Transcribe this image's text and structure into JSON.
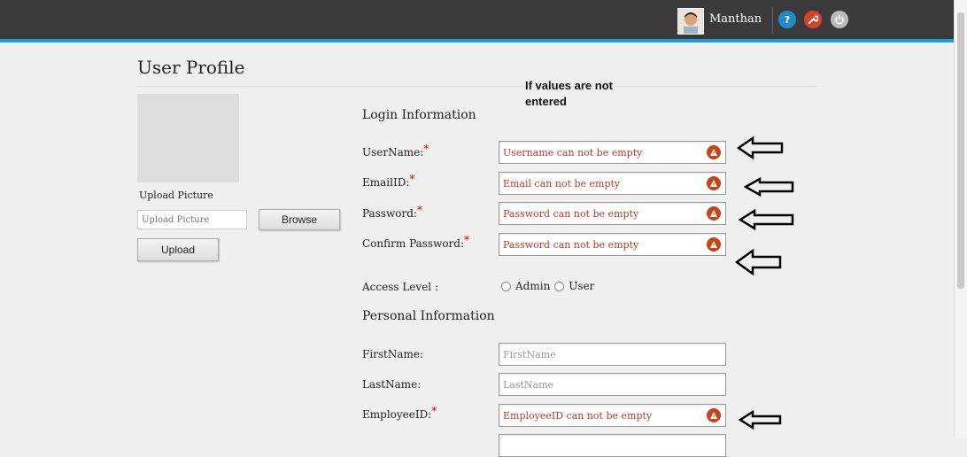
{
  "header": {
    "user_name": "Manthan",
    "icons": [
      "help-icon",
      "settings-wrench-icon",
      "power-icon"
    ],
    "accent_color": "#1b9be0"
  },
  "page": {
    "title": "User Profile"
  },
  "annotation": {
    "text": "If values are not entered"
  },
  "picture": {
    "upload_label": "Upload Picture",
    "input_placeholder": "Upload Picture",
    "browse_label": "Browse",
    "upload_label_btn": "Upload"
  },
  "login": {
    "section_title": "Login Information",
    "username": {
      "label": "UserName:",
      "error": "Username can not be empty"
    },
    "email": {
      "label": "EmailID:",
      "error": "Email can not be empty"
    },
    "password": {
      "label": "Password:",
      "error": "Password can not be empty"
    },
    "confirm": {
      "label": "Confirm Password:",
      "error": "Password can not be empty"
    },
    "access": {
      "label": "Access Level :",
      "options": [
        "Admin",
        "User"
      ]
    },
    "required_marker": "*"
  },
  "personal": {
    "section_title": "Personal Information",
    "firstname": {
      "label": "FirstName:",
      "placeholder": "FirstName"
    },
    "lastname": {
      "label": "LastName:",
      "placeholder": "LastName"
    },
    "employeeid": {
      "label": "EmployeeID:",
      "error": "EmployeeID can not be empty"
    }
  },
  "colors": {
    "error_text": "#b83a2a",
    "warning_icon": "#c5441c",
    "required": "#dd0000"
  }
}
